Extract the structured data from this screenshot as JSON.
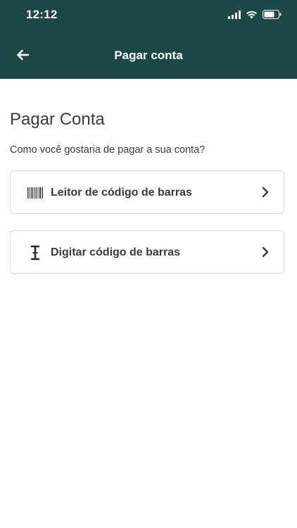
{
  "status_bar": {
    "time": "12:12",
    "icons": [
      "signal-icon",
      "wifi-icon",
      "battery-icon"
    ]
  },
  "header": {
    "title": "Pagar conta",
    "back_icon": "arrow-left-icon"
  },
  "main": {
    "title": "Pagar Conta",
    "subtitle": "Como você gostaria de pagar a sua conta?",
    "options": [
      {
        "label": "Leitor de código de barras",
        "icon": "barcode-icon",
        "chevron": "chevron-right-icon"
      },
      {
        "label": "Digitar código de barras",
        "icon": "text-cursor-icon",
        "chevron": "chevron-right-icon"
      }
    ]
  },
  "colors": {
    "header_bg": "#1d4848",
    "text": "#3a3a3a",
    "card_border": "#d9d9d9"
  }
}
